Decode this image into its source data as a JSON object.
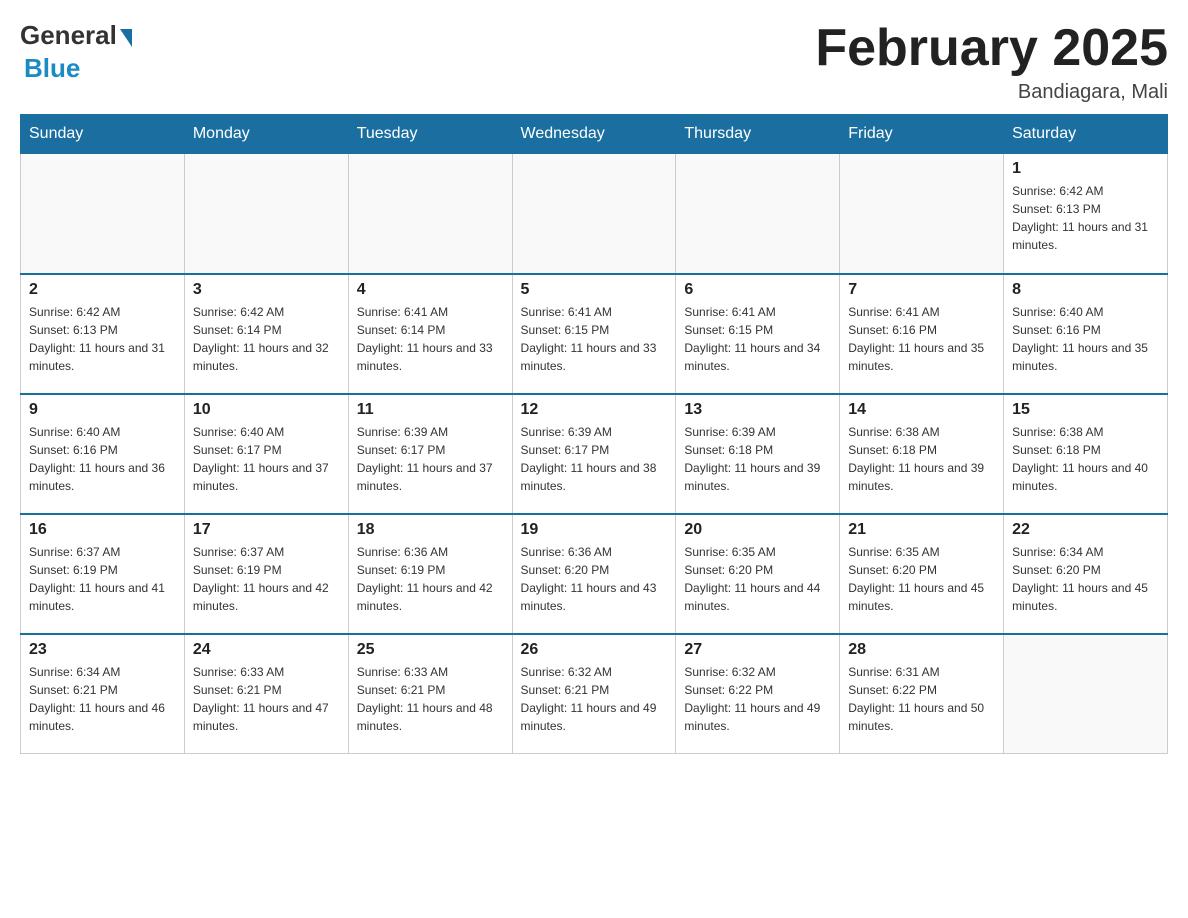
{
  "header": {
    "logo_general": "General",
    "logo_blue": "Blue",
    "month_title": "February 2025",
    "location": "Bandiagara, Mali"
  },
  "days_of_week": [
    "Sunday",
    "Monday",
    "Tuesday",
    "Wednesday",
    "Thursday",
    "Friday",
    "Saturday"
  ],
  "weeks": [
    [
      {
        "day": "",
        "sunrise": "",
        "sunset": "",
        "daylight": ""
      },
      {
        "day": "",
        "sunrise": "",
        "sunset": "",
        "daylight": ""
      },
      {
        "day": "",
        "sunrise": "",
        "sunset": "",
        "daylight": ""
      },
      {
        "day": "",
        "sunrise": "",
        "sunset": "",
        "daylight": ""
      },
      {
        "day": "",
        "sunrise": "",
        "sunset": "",
        "daylight": ""
      },
      {
        "day": "",
        "sunrise": "",
        "sunset": "",
        "daylight": ""
      },
      {
        "day": "1",
        "sunrise": "Sunrise: 6:42 AM",
        "sunset": "Sunset: 6:13 PM",
        "daylight": "Daylight: 11 hours and 31 minutes."
      }
    ],
    [
      {
        "day": "2",
        "sunrise": "Sunrise: 6:42 AM",
        "sunset": "Sunset: 6:13 PM",
        "daylight": "Daylight: 11 hours and 31 minutes."
      },
      {
        "day": "3",
        "sunrise": "Sunrise: 6:42 AM",
        "sunset": "Sunset: 6:14 PM",
        "daylight": "Daylight: 11 hours and 32 minutes."
      },
      {
        "day": "4",
        "sunrise": "Sunrise: 6:41 AM",
        "sunset": "Sunset: 6:14 PM",
        "daylight": "Daylight: 11 hours and 33 minutes."
      },
      {
        "day": "5",
        "sunrise": "Sunrise: 6:41 AM",
        "sunset": "Sunset: 6:15 PM",
        "daylight": "Daylight: 11 hours and 33 minutes."
      },
      {
        "day": "6",
        "sunrise": "Sunrise: 6:41 AM",
        "sunset": "Sunset: 6:15 PM",
        "daylight": "Daylight: 11 hours and 34 minutes."
      },
      {
        "day": "7",
        "sunrise": "Sunrise: 6:41 AM",
        "sunset": "Sunset: 6:16 PM",
        "daylight": "Daylight: 11 hours and 35 minutes."
      },
      {
        "day": "8",
        "sunrise": "Sunrise: 6:40 AM",
        "sunset": "Sunset: 6:16 PM",
        "daylight": "Daylight: 11 hours and 35 minutes."
      }
    ],
    [
      {
        "day": "9",
        "sunrise": "Sunrise: 6:40 AM",
        "sunset": "Sunset: 6:16 PM",
        "daylight": "Daylight: 11 hours and 36 minutes."
      },
      {
        "day": "10",
        "sunrise": "Sunrise: 6:40 AM",
        "sunset": "Sunset: 6:17 PM",
        "daylight": "Daylight: 11 hours and 37 minutes."
      },
      {
        "day": "11",
        "sunrise": "Sunrise: 6:39 AM",
        "sunset": "Sunset: 6:17 PM",
        "daylight": "Daylight: 11 hours and 37 minutes."
      },
      {
        "day": "12",
        "sunrise": "Sunrise: 6:39 AM",
        "sunset": "Sunset: 6:17 PM",
        "daylight": "Daylight: 11 hours and 38 minutes."
      },
      {
        "day": "13",
        "sunrise": "Sunrise: 6:39 AM",
        "sunset": "Sunset: 6:18 PM",
        "daylight": "Daylight: 11 hours and 39 minutes."
      },
      {
        "day": "14",
        "sunrise": "Sunrise: 6:38 AM",
        "sunset": "Sunset: 6:18 PM",
        "daylight": "Daylight: 11 hours and 39 minutes."
      },
      {
        "day": "15",
        "sunrise": "Sunrise: 6:38 AM",
        "sunset": "Sunset: 6:18 PM",
        "daylight": "Daylight: 11 hours and 40 minutes."
      }
    ],
    [
      {
        "day": "16",
        "sunrise": "Sunrise: 6:37 AM",
        "sunset": "Sunset: 6:19 PM",
        "daylight": "Daylight: 11 hours and 41 minutes."
      },
      {
        "day": "17",
        "sunrise": "Sunrise: 6:37 AM",
        "sunset": "Sunset: 6:19 PM",
        "daylight": "Daylight: 11 hours and 42 minutes."
      },
      {
        "day": "18",
        "sunrise": "Sunrise: 6:36 AM",
        "sunset": "Sunset: 6:19 PM",
        "daylight": "Daylight: 11 hours and 42 minutes."
      },
      {
        "day": "19",
        "sunrise": "Sunrise: 6:36 AM",
        "sunset": "Sunset: 6:20 PM",
        "daylight": "Daylight: 11 hours and 43 minutes."
      },
      {
        "day": "20",
        "sunrise": "Sunrise: 6:35 AM",
        "sunset": "Sunset: 6:20 PM",
        "daylight": "Daylight: 11 hours and 44 minutes."
      },
      {
        "day": "21",
        "sunrise": "Sunrise: 6:35 AM",
        "sunset": "Sunset: 6:20 PM",
        "daylight": "Daylight: 11 hours and 45 minutes."
      },
      {
        "day": "22",
        "sunrise": "Sunrise: 6:34 AM",
        "sunset": "Sunset: 6:20 PM",
        "daylight": "Daylight: 11 hours and 45 minutes."
      }
    ],
    [
      {
        "day": "23",
        "sunrise": "Sunrise: 6:34 AM",
        "sunset": "Sunset: 6:21 PM",
        "daylight": "Daylight: 11 hours and 46 minutes."
      },
      {
        "day": "24",
        "sunrise": "Sunrise: 6:33 AM",
        "sunset": "Sunset: 6:21 PM",
        "daylight": "Daylight: 11 hours and 47 minutes."
      },
      {
        "day": "25",
        "sunrise": "Sunrise: 6:33 AM",
        "sunset": "Sunset: 6:21 PM",
        "daylight": "Daylight: 11 hours and 48 minutes."
      },
      {
        "day": "26",
        "sunrise": "Sunrise: 6:32 AM",
        "sunset": "Sunset: 6:21 PM",
        "daylight": "Daylight: 11 hours and 49 minutes."
      },
      {
        "day": "27",
        "sunrise": "Sunrise: 6:32 AM",
        "sunset": "Sunset: 6:22 PM",
        "daylight": "Daylight: 11 hours and 49 minutes."
      },
      {
        "day": "28",
        "sunrise": "Sunrise: 6:31 AM",
        "sunset": "Sunset: 6:22 PM",
        "daylight": "Daylight: 11 hours and 50 minutes."
      },
      {
        "day": "",
        "sunrise": "",
        "sunset": "",
        "daylight": ""
      }
    ]
  ]
}
